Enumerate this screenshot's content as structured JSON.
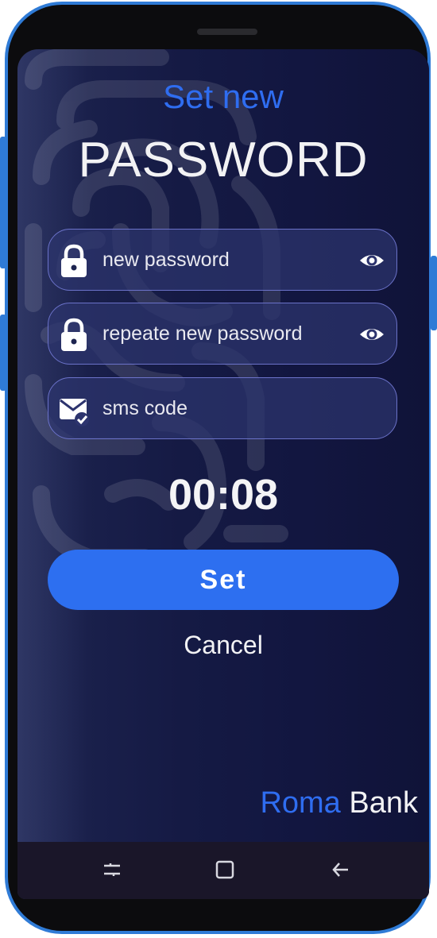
{
  "header": {
    "title_small": "Set new",
    "title_big": "PASSWORD"
  },
  "fields": [
    {
      "label": "new password",
      "icon": "lock-icon",
      "toggle_icon": "eye-icon"
    },
    {
      "label": "repeate new password",
      "icon": "lock-icon",
      "toggle_icon": "eye-icon"
    },
    {
      "label": "sms code",
      "icon": "sms-check-icon"
    }
  ],
  "timer": {
    "value": "00:08"
  },
  "actions": {
    "set_label": "Set",
    "cancel_label": "Cancel"
  },
  "brand": {
    "part1": "Roma",
    "part2": "Bank"
  },
  "colors": {
    "accent": "#2f6df0",
    "background": "#151a44",
    "field_border": "#6b72c9",
    "frame": "#2f7bd6"
  },
  "navbar": {
    "items": [
      "recent-apps-icon",
      "home-icon",
      "back-icon"
    ]
  }
}
